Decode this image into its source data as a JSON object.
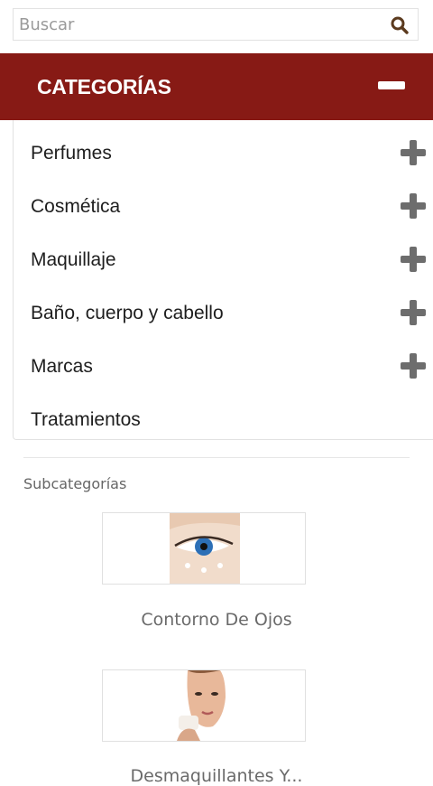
{
  "search": {
    "placeholder": "Buscar",
    "icon": "search-icon"
  },
  "categories": {
    "title": "CATEGORÍAS",
    "collapse_icon": "minus-icon",
    "items": [
      {
        "label": "Perfumes",
        "expandable": true
      },
      {
        "label": "Cosmética",
        "expandable": true
      },
      {
        "label": "Maquillaje",
        "expandable": true
      },
      {
        "label": "Baño, cuerpo y cabello",
        "expandable": true
      },
      {
        "label": "Marcas",
        "expandable": true
      },
      {
        "label": "Tratamientos",
        "expandable": false
      }
    ]
  },
  "subcategories": {
    "title": "Subcategorías",
    "items": [
      {
        "label": "Contorno De Ojos"
      },
      {
        "label": "Desmaquillantes Y..."
      }
    ]
  },
  "colors": {
    "header_bg": "#871a15",
    "plus_icon": "#6d6d6d",
    "search_icon": "#5b3a1e"
  }
}
